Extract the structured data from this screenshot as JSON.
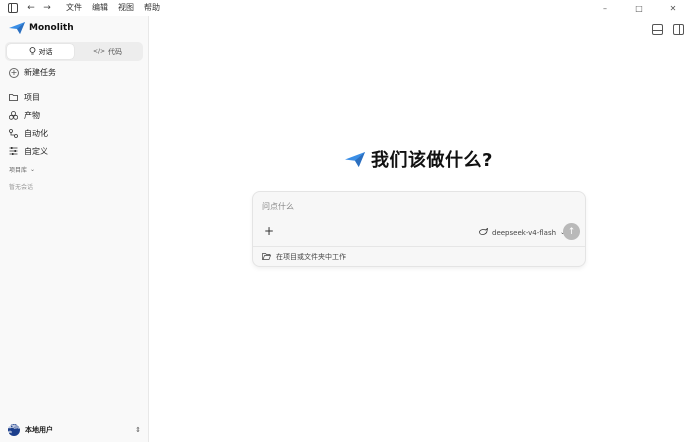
{
  "titlebar": {
    "menus": [
      "文件",
      "编辑",
      "视图",
      "帮助"
    ],
    "minimize": "–",
    "maximize": "□",
    "close": "✕"
  },
  "sidebar": {
    "brand": "Monolith",
    "modes": [
      {
        "label": "对话",
        "icon": "lightbulb-icon",
        "active": true
      },
      {
        "label": "代码",
        "icon": "code-icon",
        "active": false
      }
    ],
    "new_task": "新建任务",
    "nav": [
      {
        "label": "项目",
        "icon": "folder-icon"
      },
      {
        "label": "产物",
        "icon": "artifacts-icon"
      },
      {
        "label": "自动化",
        "icon": "automation-icon"
      },
      {
        "label": "自定义",
        "icon": "sliders-icon"
      }
    ],
    "section_label": "项目库",
    "empty_label": "暂无会话",
    "user": {
      "avatar_text": "本地用户",
      "name": "本地用户"
    }
  },
  "main": {
    "title": "我们该做什么?",
    "composer": {
      "placeholder": "问点什么",
      "model": "deepseek-v4-flash",
      "workdir_label": "在项目或文件夹中工作"
    }
  },
  "colors": {
    "accent": "#3a8ee6",
    "avatar_bg": "#1c3f8c",
    "send_btn": "#b9b9b9"
  }
}
